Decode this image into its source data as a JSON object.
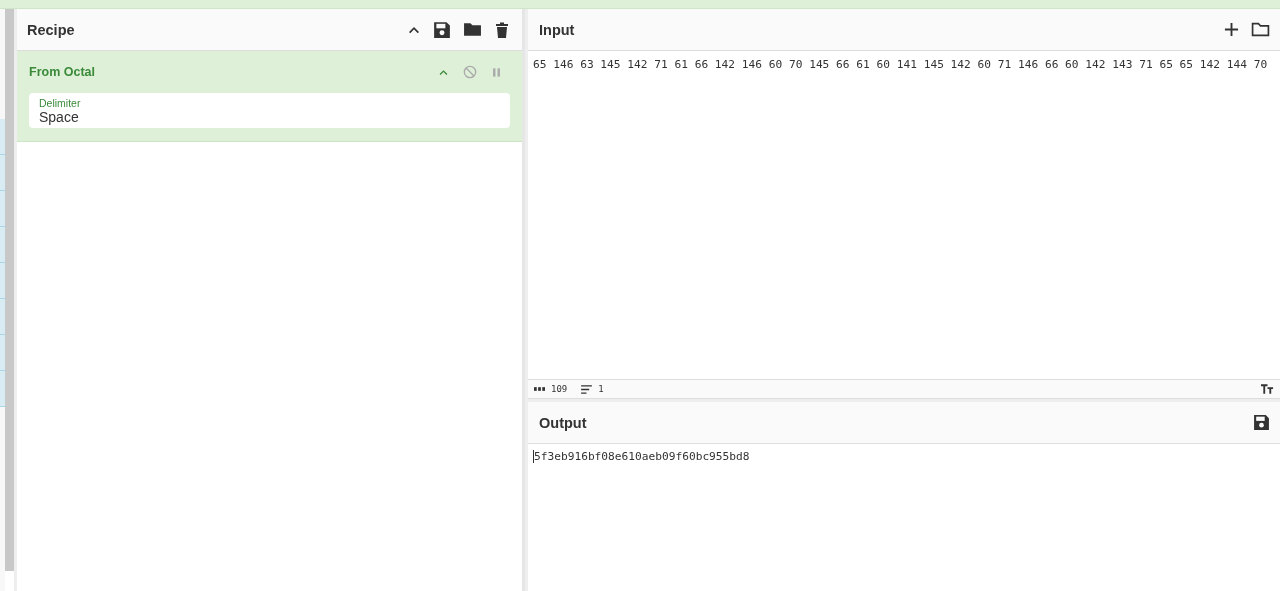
{
  "recipe": {
    "title": "Recipe",
    "operations": [
      {
        "name": "From Octal",
        "disabled": false,
        "breakpoint": false,
        "args": [
          {
            "label": "Delimiter",
            "value": "Space"
          }
        ]
      }
    ]
  },
  "input": {
    "title": "Input",
    "text": "65 146 63 145 142 71 61 66 142 146 60 70 145 66 61 60 141 145 142 60 71 146 66 60 142 143 71 65 65 142 144 70",
    "length": "109",
    "lines": "1"
  },
  "output": {
    "title": "Output",
    "text": "5f3eb916bf08e610aeb09f60bc955bd8"
  }
}
